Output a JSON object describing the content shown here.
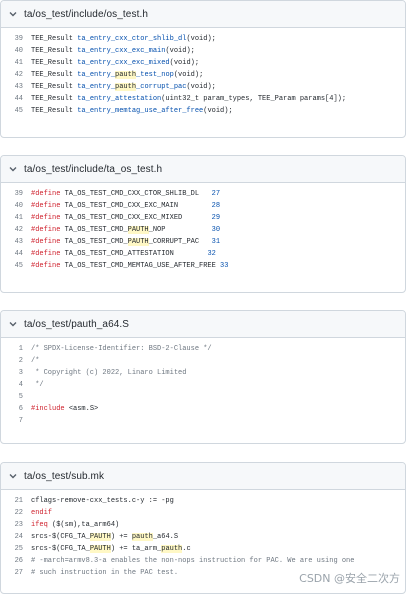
{
  "files": [
    {
      "path": "ta/os_test/include/os_test.h",
      "lines": [
        {
          "n": "39",
          "parts": [
            [
              "TEE_Result ",
              ""
            ],
            [
              "ta_entry_cxx_ctor_shlib_dl",
              "fn"
            ],
            [
              "(void);",
              ""
            ]
          ]
        },
        {
          "n": "40",
          "parts": [
            [
              "TEE_Result ",
              ""
            ],
            [
              "ta_entry_cxx_exc_main",
              "fn"
            ],
            [
              "(void);",
              ""
            ]
          ]
        },
        {
          "n": "41",
          "parts": [
            [
              "TEE_Result ",
              ""
            ],
            [
              "ta_entry_cxx_exc_mixed",
              "fn"
            ],
            [
              "(void);",
              ""
            ]
          ]
        },
        {
          "n": "42",
          "parts": [
            [
              "TEE_Result ",
              ""
            ],
            [
              "ta_entry_",
              "fn"
            ],
            [
              "pauth",
              "hl"
            ],
            [
              "_test_nop",
              "fn"
            ],
            [
              "(void);",
              ""
            ]
          ]
        },
        {
          "n": "43",
          "parts": [
            [
              "TEE_Result ",
              ""
            ],
            [
              "ta_entry_",
              "fn"
            ],
            [
              "pauth",
              "hl"
            ],
            [
              "_corrupt_pac",
              "fn"
            ],
            [
              "(void);",
              ""
            ]
          ]
        },
        {
          "n": "44",
          "parts": [
            [
              "TEE_Result ",
              ""
            ],
            [
              "ta_entry_attestation",
              "fn"
            ],
            [
              "(uint32_t param_types, TEE_Param params[4]);",
              ""
            ]
          ]
        },
        {
          "n": "45",
          "parts": [
            [
              "TEE_Result ",
              ""
            ],
            [
              "ta_entry_memtag_use_after_free",
              "fn"
            ],
            [
              "(void);",
              ""
            ]
          ]
        }
      ]
    },
    {
      "path": "ta/os_test/include/ta_os_test.h",
      "lines": [
        {
          "n": "39",
          "parts": [
            [
              "#define ",
              "kw"
            ],
            [
              "TA_OS_TEST_CMD_CXX_CTOR_SHLIB_DL   ",
              ""
            ],
            [
              "27",
              "num"
            ]
          ]
        },
        {
          "n": "40",
          "parts": [
            [
              "#define ",
              "kw"
            ],
            [
              "TA_OS_TEST_CMD_CXX_EXC_MAIN        ",
              ""
            ],
            [
              "28",
              "num"
            ]
          ]
        },
        {
          "n": "41",
          "parts": [
            [
              "#define ",
              "kw"
            ],
            [
              "TA_OS_TEST_CMD_CXX_EXC_MIXED       ",
              ""
            ],
            [
              "29",
              "num"
            ]
          ]
        },
        {
          "n": "42",
          "parts": [
            [
              "#define ",
              "kw"
            ],
            [
              "TA_OS_TEST_CMD_",
              ""
            ],
            [
              "PAUTH",
              "hl"
            ],
            [
              "_NOP           ",
              ""
            ],
            [
              "30",
              "num"
            ]
          ]
        },
        {
          "n": "43",
          "parts": [
            [
              "#define ",
              "kw"
            ],
            [
              "TA_OS_TEST_CMD_",
              ""
            ],
            [
              "PAUTH",
              "hl"
            ],
            [
              "_CORRUPT_PAC   ",
              ""
            ],
            [
              "31",
              "num"
            ]
          ]
        },
        {
          "n": "44",
          "parts": [
            [
              "#define ",
              "kw"
            ],
            [
              "TA_OS_TEST_CMD_ATTESTATION        ",
              ""
            ],
            [
              "32",
              "num"
            ]
          ]
        },
        {
          "n": "45",
          "parts": [
            [
              "#define ",
              "kw"
            ],
            [
              "TA_OS_TEST_CMD_MEMTAG_USE_AFTER_FREE ",
              ""
            ],
            [
              "33",
              "num"
            ]
          ]
        }
      ]
    },
    {
      "path": "ta/os_test/pauth_a64.S",
      "lines": [
        {
          "n": "1",
          "parts": [
            [
              "/* SPDX-License-Identifier: BSD-2-Clause */",
              "cm"
            ]
          ]
        },
        {
          "n": "2",
          "parts": [
            [
              "/*",
              "cm"
            ]
          ]
        },
        {
          "n": "3",
          "parts": [
            [
              " * Copyright (c) 2022, Linaro Limited",
              "cm"
            ]
          ]
        },
        {
          "n": "4",
          "parts": [
            [
              " */",
              "cm"
            ]
          ]
        },
        {
          "n": "5",
          "parts": [
            [
              "",
              ""
            ]
          ]
        },
        {
          "n": "6",
          "parts": [
            [
              "#include ",
              "kw"
            ],
            [
              "<asm.S>",
              ""
            ]
          ]
        },
        {
          "n": "7",
          "parts": [
            [
              "",
              ""
            ]
          ]
        }
      ]
    },
    {
      "path": "ta/os_test/sub.mk",
      "lines": [
        {
          "n": "21",
          "parts": [
            [
              "cflags-remove-cxx_tests.c-y := -pg",
              ""
            ]
          ]
        },
        {
          "n": "22",
          "parts": [
            [
              "endif",
              "kw"
            ]
          ]
        },
        {
          "n": "23",
          "parts": [
            [
              "ifeq ",
              "kw"
            ],
            [
              "($(sm),ta_arm64)",
              ""
            ]
          ]
        },
        {
          "n": "24",
          "parts": [
            [
              "srcs-$(CFG_TA_",
              ""
            ],
            [
              "PAUTH",
              "hl"
            ],
            [
              ") += ",
              ""
            ],
            [
              "pauth",
              "hl"
            ],
            [
              "_a64.S",
              ""
            ]
          ]
        },
        {
          "n": "25",
          "parts": [
            [
              "srcs-$(CFG_TA_",
              ""
            ],
            [
              "PAUTH",
              "hl"
            ],
            [
              ") += ta_arm_",
              ""
            ],
            [
              "pauth",
              "hl"
            ],
            [
              ".c",
              ""
            ]
          ]
        },
        {
          "n": "26",
          "parts": [
            [
              "# -march=armv8.3-a enables the non-nops instruction for PAC. We are using one",
              "cm"
            ]
          ]
        },
        {
          "n": "27",
          "parts": [
            [
              "# such instruction in the PAC test.",
              "cm"
            ]
          ]
        }
      ]
    }
  ],
  "watermark": "CSDN @安全二次方"
}
